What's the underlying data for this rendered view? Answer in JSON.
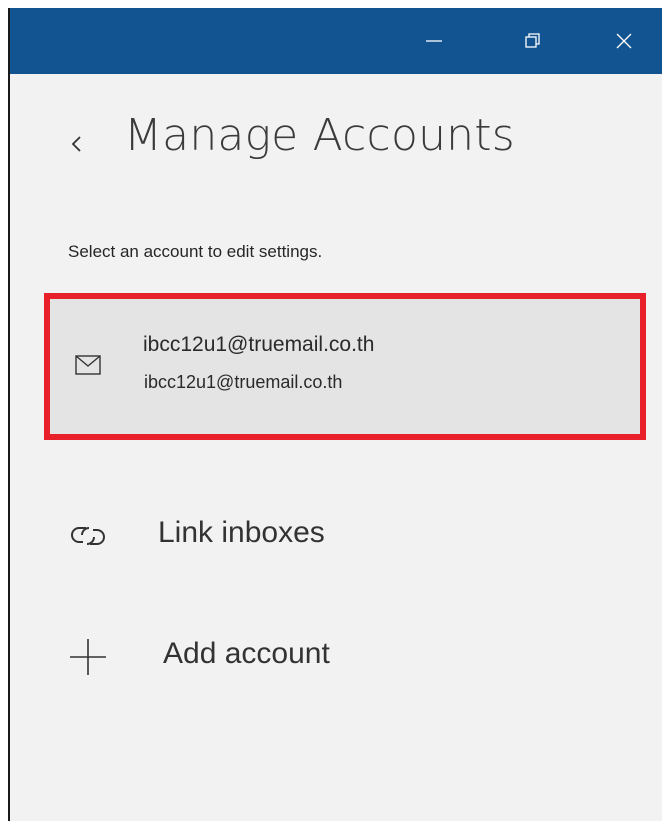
{
  "window": {
    "controls": {
      "minimize_icon": "minimize-icon",
      "maximize_icon": "restore-icon",
      "close_icon": "close-icon"
    },
    "titlebar_color": "#125391"
  },
  "header": {
    "back_icon": "chevron-left-icon",
    "title": "Manage Accounts"
  },
  "instructions": "Select an account to edit settings.",
  "accounts": [
    {
      "icon": "mail-icon",
      "name": "ibcc12u1@truemail.co.th",
      "email": "ibcc12u1@truemail.co.th",
      "highlight_color": "#e8202a"
    }
  ],
  "actions": {
    "link_inboxes": {
      "icon": "link-icon",
      "label": "Link inboxes"
    },
    "add_account": {
      "icon": "plus-icon",
      "label": "Add account"
    }
  }
}
